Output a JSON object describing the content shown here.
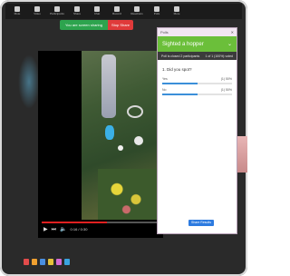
{
  "toolbar": {
    "buttons": [
      {
        "icon": "mute-icon",
        "label": "Mute"
      },
      {
        "icon": "video-icon",
        "label": "Video"
      },
      {
        "icon": "participants-icon",
        "label": "Participants"
      },
      {
        "icon": "share-icon",
        "label": "Share"
      },
      {
        "icon": "chat-icon",
        "label": "Chat"
      },
      {
        "icon": "record-icon",
        "label": "Record"
      },
      {
        "icon": "reactions-icon",
        "label": "Reactions"
      },
      {
        "icon": "polls-icon",
        "label": "Polls"
      },
      {
        "icon": "more-icon",
        "label": "More"
      }
    ]
  },
  "banner": {
    "sharing_label": "You are screen sharing",
    "stop_label": "Stop Share"
  },
  "video": {
    "progress_fraction": 0.55,
    "time": "0:16 / 0:30"
  },
  "panel": {
    "window_title": "Polls",
    "header_title": "Sighted a hopper",
    "subbar_left": "Poll is closed 2 participants",
    "subbar_right": "1 of 1 (100%) voted",
    "question": "1. Did you spot?",
    "options": [
      {
        "label": "Yes",
        "value": "(1) 50%",
        "fraction": 0.5
      },
      {
        "label": "No",
        "value": "(1) 50%",
        "fraction": 0.5
      }
    ],
    "share_button": "Share Results"
  },
  "colors": {
    "panel_header": "#6bbf3a",
    "banner_green": "#2da44e",
    "banner_red": "#e03a3a",
    "poll_bar": "#3b8fd9",
    "progress": "#e02020"
  },
  "taskbar": {
    "icons": [
      {
        "name": "app-icon-1",
        "color": "#e24b4b"
      },
      {
        "name": "app-icon-2",
        "color": "#f0a030"
      },
      {
        "name": "app-icon-3",
        "color": "#4a8fe0"
      },
      {
        "name": "app-icon-4",
        "color": "#e5c23a"
      },
      {
        "name": "app-icon-5",
        "color": "#d46ad4"
      },
      {
        "name": "app-icon-6",
        "color": "#3aa3e0"
      }
    ]
  }
}
